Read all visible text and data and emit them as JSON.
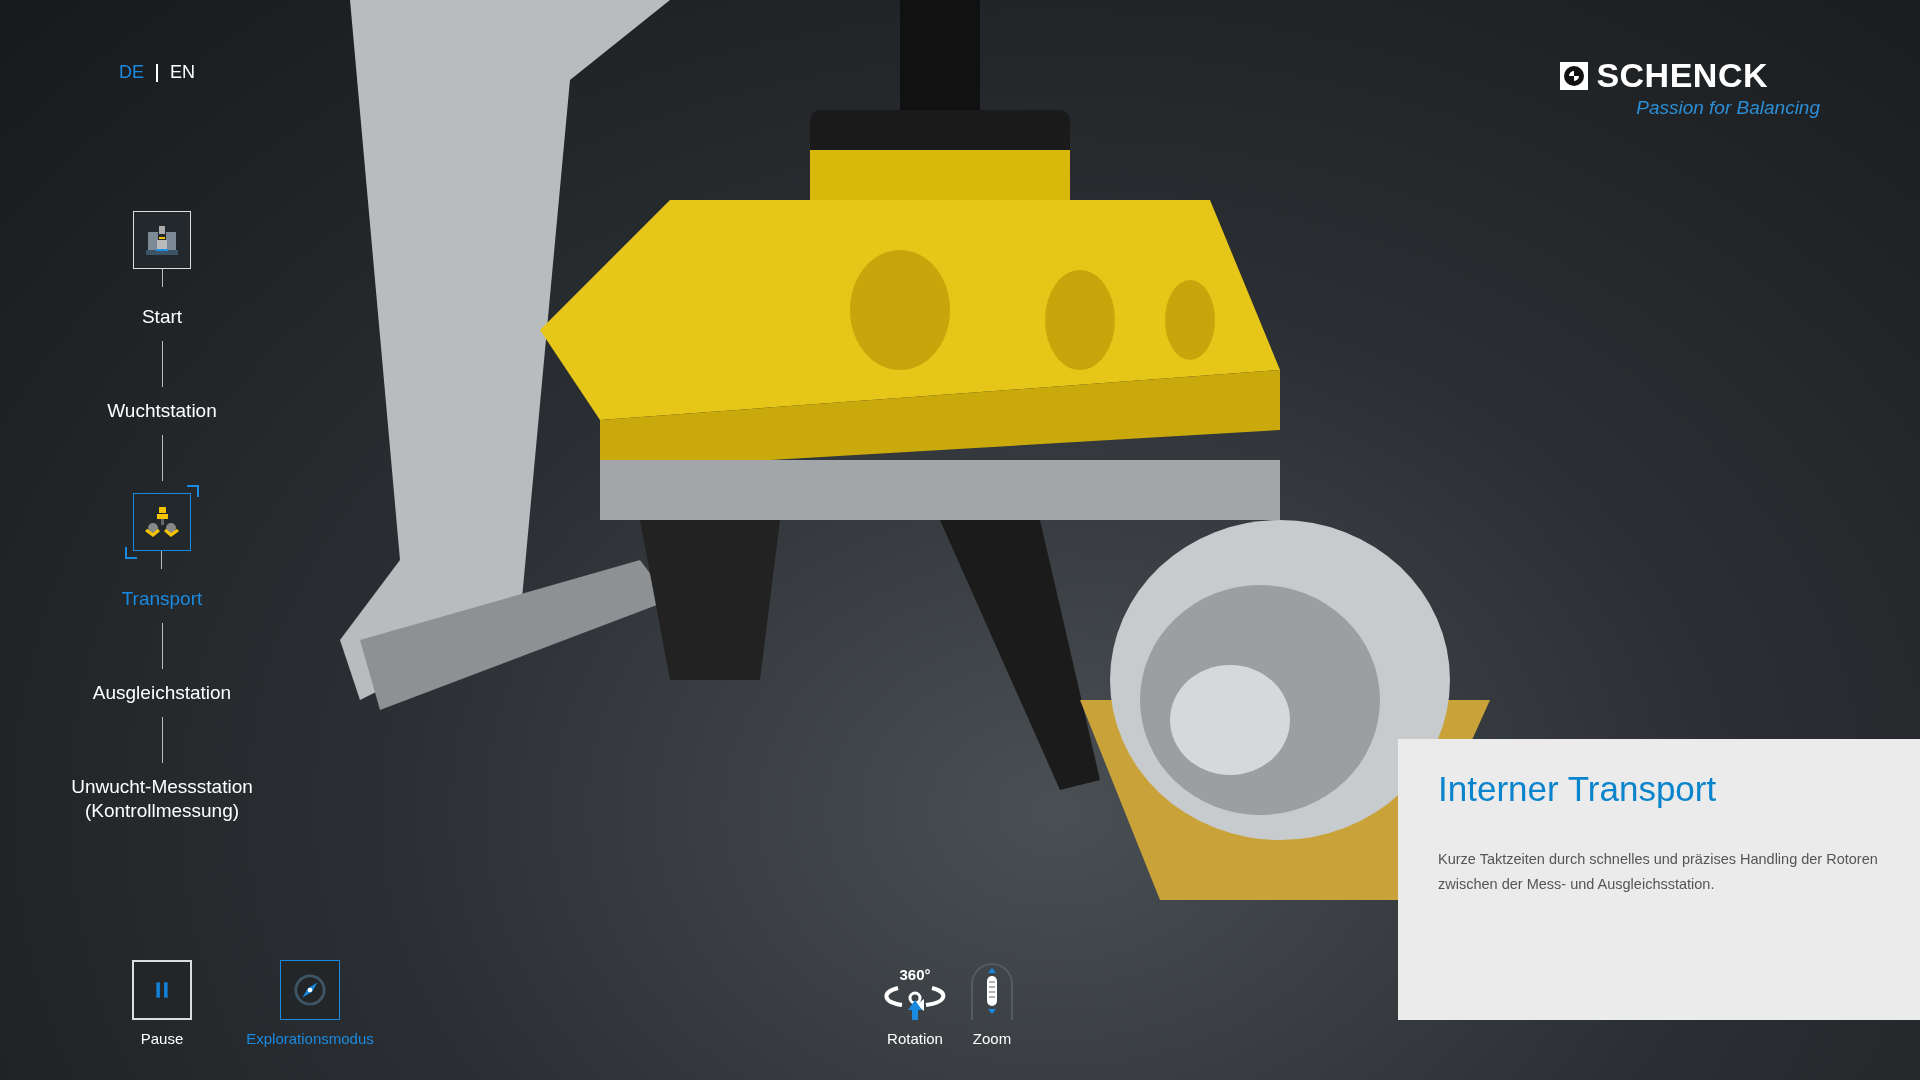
{
  "languages": [
    {
      "label": "DE",
      "selected": true
    },
    {
      "label": "EN",
      "selected": false
    }
  ],
  "logo": {
    "name": "SCHENCK",
    "tagline": "Passion for Balancing"
  },
  "steps": [
    {
      "label": "Start",
      "kind": "machine",
      "selected": false
    },
    {
      "label": "Wuchtstation",
      "kind": "plain",
      "selected": false
    },
    {
      "label": "Transport",
      "kind": "gripper",
      "selected": true
    },
    {
      "label": "Ausgleichstation",
      "kind": "plain",
      "selected": false
    },
    {
      "label": "Unwucht-Messstation\n(Kontrollmessung)",
      "kind": "plain",
      "selected": false
    }
  ],
  "modes": [
    {
      "label": "Pause",
      "kind": "pause",
      "active": false
    },
    {
      "label": "Explorationsmodus",
      "kind": "explore",
      "active": true
    }
  ],
  "hints": [
    {
      "label": "Rotation",
      "kind": "rotation",
      "badge": "360°"
    },
    {
      "label": "Zoom",
      "kind": "zoom"
    }
  ],
  "info_panel": {
    "title": "Interner Transport",
    "text": "Kurze Taktzeiten durch schnelles und präzises Handling der Rotoren zwischen der Mess- und Ausgleichsstation."
  }
}
